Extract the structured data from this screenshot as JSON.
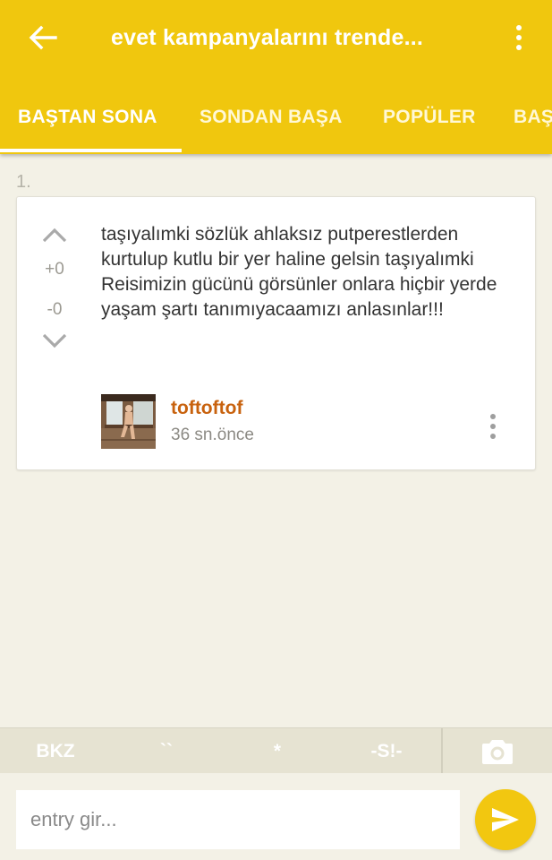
{
  "app_bar": {
    "title": "evet kampanyalarını trende...",
    "back_icon": "arrow-left-icon",
    "overflow_icon": "more-vert-icon",
    "background_color": "#f0c70e"
  },
  "tabs": [
    {
      "label": "BAŞTAN SONA",
      "active": true
    },
    {
      "label": "SONDAN BAŞA",
      "active": false
    },
    {
      "label": "POPÜLER",
      "active": false
    },
    {
      "label": "BAŞ",
      "active": false
    }
  ],
  "entry": {
    "number": "1.",
    "up_count": "+0",
    "down_count": "-0",
    "text": "taşıyalımki sözlük ahlaksız putperestlerden kurtulup kutlu bir yer haline gelsin taşıyalımki Reisimizin gücünü görsünler onlara hiçbir yerde yaşam şartı tanımıyacaamızı anlasınlar!!!",
    "author": "toftoftof",
    "time": "36 sn.önce",
    "author_color": "#c8620e"
  },
  "format_bar": {
    "bkz": "BKZ",
    "backtick": "``",
    "star": "*",
    "spoiler": "-S!-",
    "camera_icon": "camera-icon"
  },
  "input": {
    "placeholder": "entry gir...",
    "value": "",
    "send_icon": "send-icon"
  }
}
